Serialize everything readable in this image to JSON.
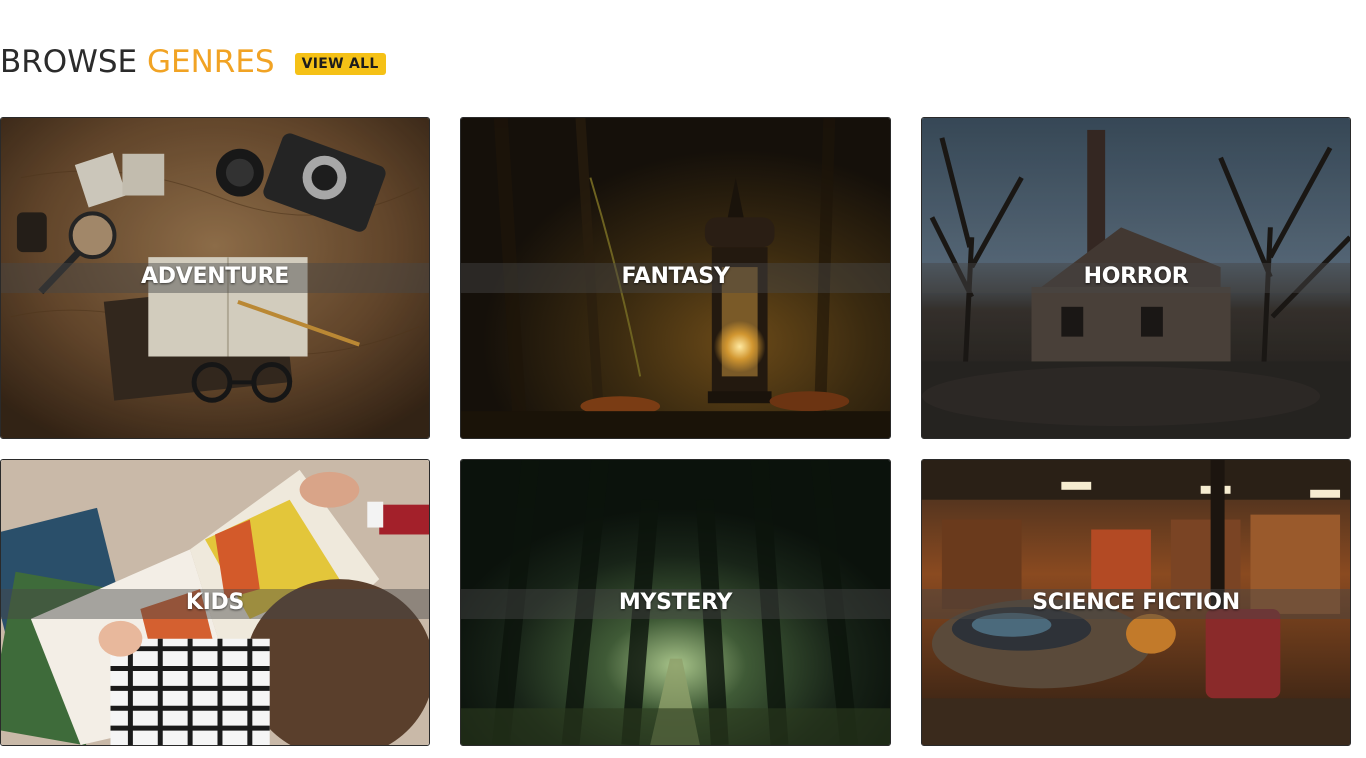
{
  "header": {
    "title_main": "BROWSE",
    "title_accent": "GENRES",
    "view_all_label": "VIEW ALL"
  },
  "genres": [
    {
      "label": "ADVENTURE"
    },
    {
      "label": "FANTASY"
    },
    {
      "label": "HORROR"
    },
    {
      "label": "KIDS"
    },
    {
      "label": "MYSTERY"
    },
    {
      "label": "SCIENCE FICTION"
    }
  ],
  "colors": {
    "accent": "#f1a324",
    "button_bg": "#f5c116",
    "title_text": "#2b2b2b"
  }
}
